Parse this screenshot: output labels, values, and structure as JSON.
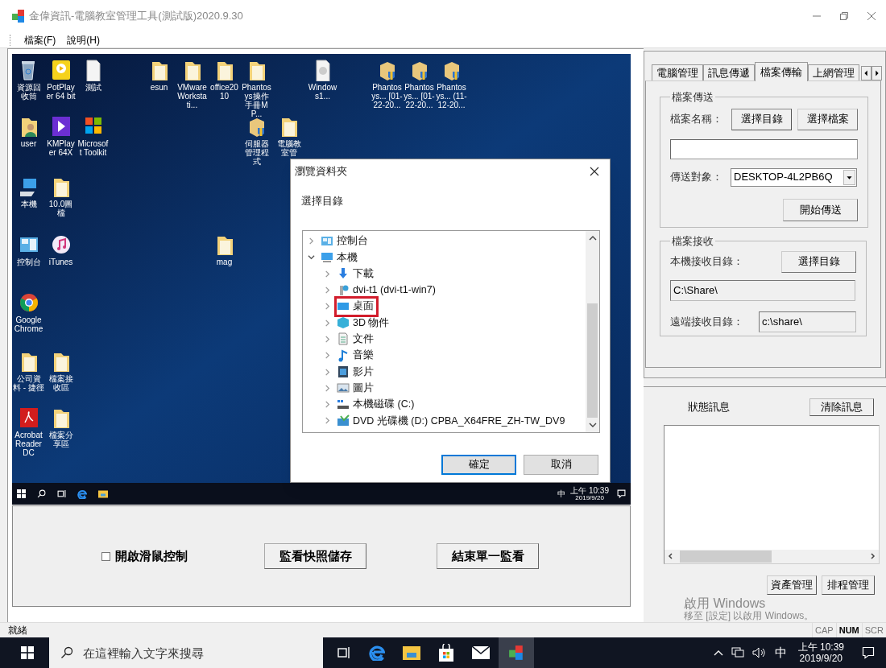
{
  "window": {
    "title": "金偉資訊-電腦教室管理工具(測試版)2020.9.30"
  },
  "menu": [
    {
      "label": "檔案(F)"
    },
    {
      "label": "說明(H)"
    }
  ],
  "remote_desktop": {
    "icons": [
      {
        "kind": "bin",
        "label": "資源回收筒"
      },
      {
        "kind": "player",
        "label": "PotPlayer 64 bit"
      },
      {
        "kind": "file",
        "label": "測試"
      },
      {
        "kind": "folder",
        "label": "esun"
      },
      {
        "kind": "folder",
        "label": "VMware Workstati..."
      },
      {
        "kind": "folder",
        "label": "office2010"
      },
      {
        "kind": "folder",
        "label": "Phantosys操作手冊MP..."
      },
      {
        "kind": "disc",
        "label": "Windows1..."
      },
      {
        "kind": "installer",
        "label": "Phantosys... [01-22-20..."
      },
      {
        "kind": "installer",
        "label": "Phantosys... [01-22-20..."
      },
      {
        "kind": "installer",
        "label": "Phantosys... (11-12-20..."
      },
      {
        "kind": "user",
        "label": "user"
      },
      {
        "kind": "kmplayer",
        "label": "KMPlayer 64X"
      },
      {
        "kind": "tiles",
        "label": "Microsoft Toolkit"
      },
      {
        "kind": "installer",
        "label": "伺服器管理程式"
      },
      {
        "kind": "folder",
        "label": "電腦教室管"
      },
      {
        "kind": "pc",
        "label": "本機"
      },
      {
        "kind": "folder",
        "label": "10.0圖檔"
      },
      {
        "kind": "control",
        "label": "控制台"
      },
      {
        "kind": "music",
        "label": "iTunes"
      },
      {
        "kind": "folder",
        "label": "mag"
      },
      {
        "kind": "chrome",
        "label": "Google Chrome"
      },
      {
        "kind": "folder",
        "label": "公司資料 - 捷徑"
      },
      {
        "kind": "folder",
        "label": "檔案接收區"
      },
      {
        "kind": "pdf",
        "label": "Acrobat Reader DC"
      },
      {
        "kind": "folder",
        "label": "檔案分享區"
      }
    ],
    "taskbar": {
      "ime": "中",
      "time": "上午 10:39",
      "date": "2019/9/20"
    },
    "dialog": {
      "title": "瀏覽資料夾",
      "prompt": "選擇目錄",
      "tree": [
        {
          "kind": "control",
          "label": "控制台",
          "expanded": false,
          "highlighted": false
        },
        {
          "kind": "pc",
          "label": "本機",
          "expanded": true,
          "highlighted": false,
          "children": [
            {
              "kind": "download",
              "label": "下載",
              "expanded": false,
              "highlighted": false
            },
            {
              "kind": "network",
              "label": "dvi-t1 (dvi-t1-win7)",
              "expanded": false,
              "highlighted": false
            },
            {
              "kind": "desktop",
              "label": "桌面",
              "expanded": false,
              "highlighted": true
            },
            {
              "kind": "objects",
              "label": "3D 物件",
              "expanded": false,
              "highlighted": false
            },
            {
              "kind": "docs",
              "label": "文件",
              "expanded": false,
              "highlighted": false
            },
            {
              "kind": "music",
              "label": "音樂",
              "expanded": false,
              "highlighted": false
            },
            {
              "kind": "video",
              "label": "影片",
              "expanded": false,
              "highlighted": false
            },
            {
              "kind": "pictures",
              "label": "圖片",
              "expanded": false,
              "highlighted": false
            },
            {
              "kind": "drive",
              "label": "本機磁碟 (C:)",
              "expanded": false,
              "highlighted": false
            },
            {
              "kind": "dvd",
              "label": "DVD 光碟機 (D:) CPBA_X64FRE_ZH-TW_DV9",
              "expanded": false,
              "highlighted": false
            }
          ]
        }
      ],
      "buttons": [
        {
          "label": "確定",
          "default": true
        },
        {
          "label": "取消",
          "default": false
        }
      ]
    }
  },
  "monitor_controls": {
    "mouse_control": {
      "label": "開啟滑鼠控制",
      "checked": false
    },
    "buttons": [
      "監看快照儲存",
      "結束單一監看"
    ]
  },
  "tabs": [
    {
      "label": "電腦管理",
      "selected": false
    },
    {
      "label": "訊息傳遞",
      "selected": false
    },
    {
      "label": "檔案傳輸",
      "selected": true
    },
    {
      "label": "上網管理",
      "selected": false
    }
  ],
  "file_send": {
    "legend": "檔案傳送",
    "filename_label": "檔案名稱：",
    "buttons": [
      "選擇目錄",
      "選擇檔案"
    ],
    "target_label": "傳送對象：",
    "target": "DESKTOP-4L2PB6Q",
    "start_button": "開始傳送"
  },
  "file_receive": {
    "legend": "檔案接收",
    "local_label": "本機接收目錄：",
    "local_button": "選擇目錄",
    "local_path": "C:\\Share\\",
    "remote_label": "遠端接收目錄：",
    "remote_path": "c:\\share\\"
  },
  "status_panel": {
    "title": "狀態訊息",
    "clear_button": "清除訊息",
    "buttons": [
      "資產管理",
      "排程管理"
    ]
  },
  "activation_notice": {
    "title": "啟用 Windows",
    "text": "移至 [設定] 以啟用 Windows。"
  },
  "status_bar": {
    "text": "就緒",
    "indicators": [
      {
        "label": "CAP",
        "on": false
      },
      {
        "label": "NUM",
        "on": true
      },
      {
        "label": "SCR",
        "on": false
      }
    ]
  },
  "taskbar": {
    "search_placeholder": "在這裡輸入文字來搜尋",
    "ime": "中",
    "time": "上午 10:39",
    "date": "2019/9/20"
  }
}
